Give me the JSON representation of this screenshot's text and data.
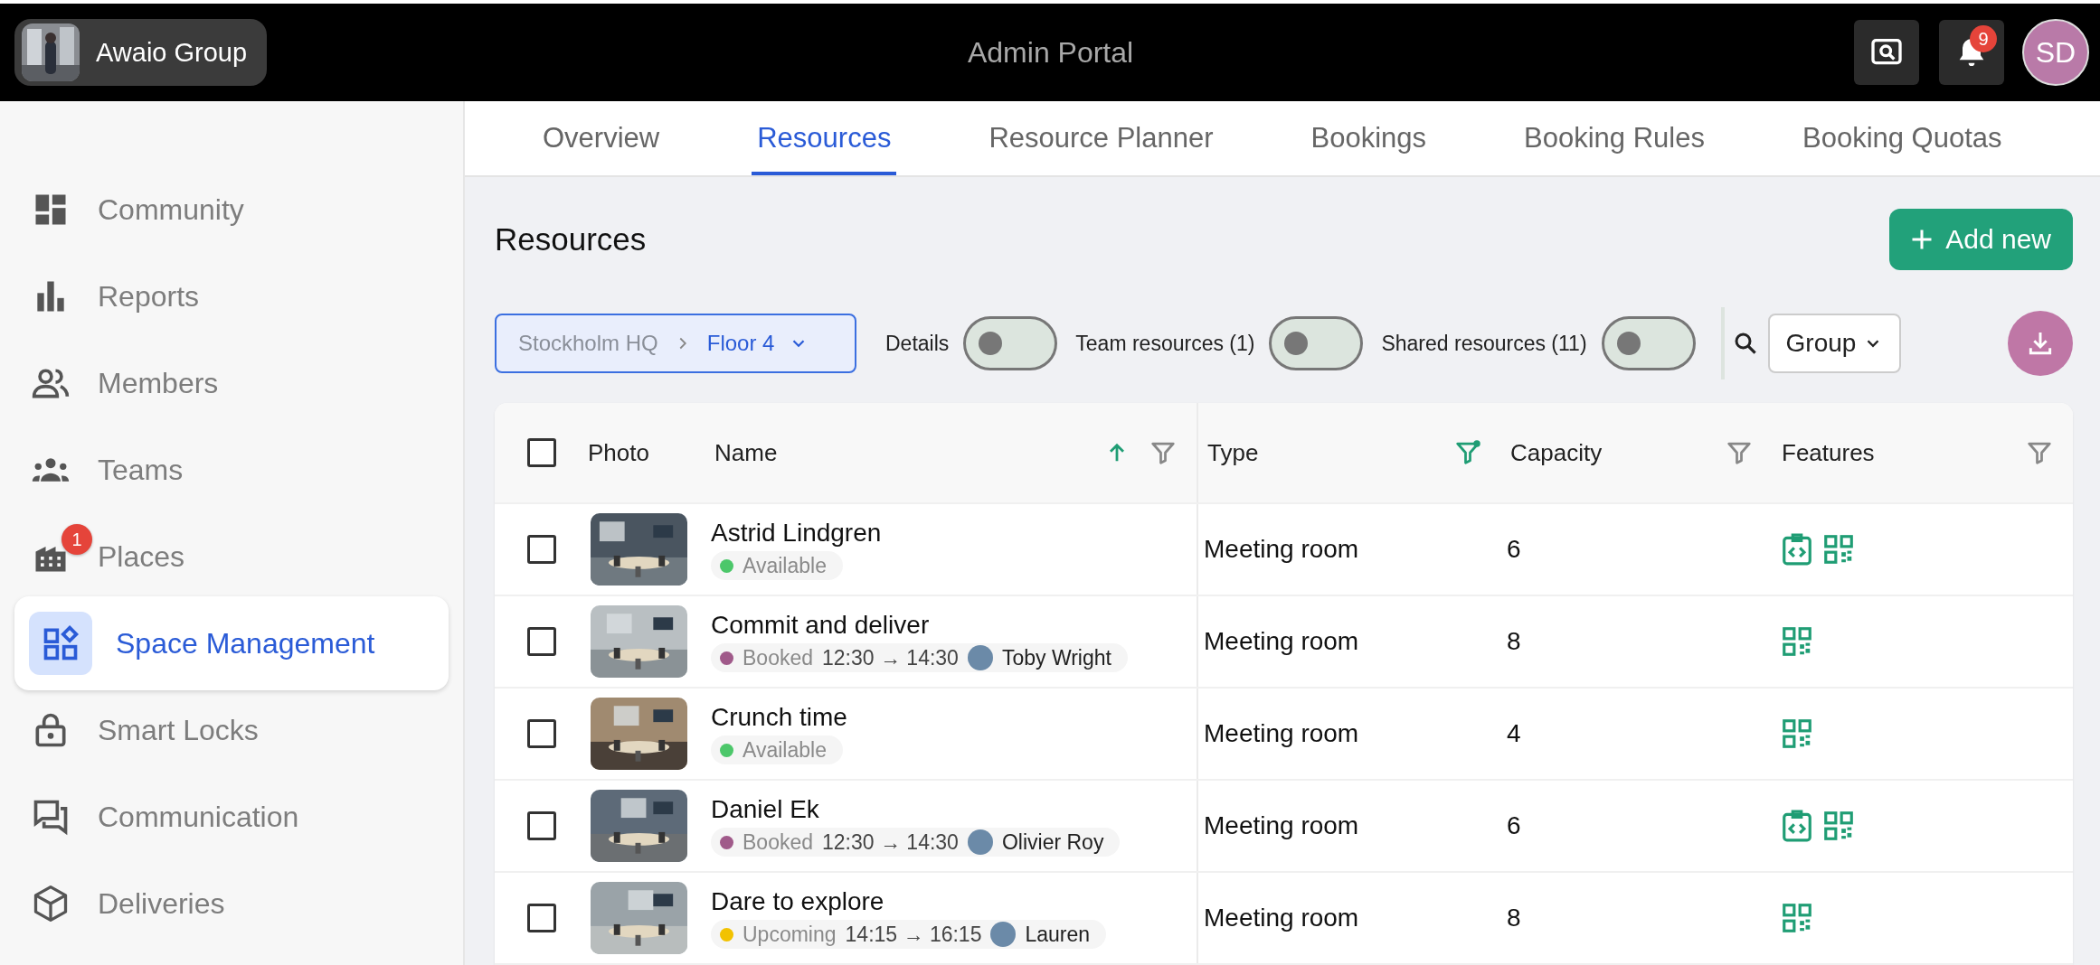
{
  "header": {
    "brand": "Awaio Group",
    "title": "Admin Portal",
    "notifications": "9",
    "avatar": "SD"
  },
  "sidebar": {
    "items": [
      {
        "label": "Community",
        "selected": false
      },
      {
        "label": "Reports",
        "selected": false
      },
      {
        "label": "Members",
        "selected": false
      },
      {
        "label": "Teams",
        "selected": false
      },
      {
        "label": "Places",
        "selected": false,
        "badge": "1"
      },
      {
        "label": "Space Management",
        "selected": true
      },
      {
        "label": "Smart Locks",
        "selected": false
      },
      {
        "label": "Communication",
        "selected": false
      },
      {
        "label": "Deliveries",
        "selected": false
      }
    ]
  },
  "tabs": [
    {
      "label": "Overview",
      "selected": false
    },
    {
      "label": "Resources",
      "selected": true
    },
    {
      "label": "Resource Planner",
      "selected": false
    },
    {
      "label": "Bookings",
      "selected": false
    },
    {
      "label": "Booking Rules",
      "selected": false
    },
    {
      "label": "Booking Quotas",
      "selected": false
    }
  ],
  "page": {
    "title": "Resources",
    "add_button": "Add new"
  },
  "filters": {
    "breadcrumb": [
      "Stockholm HQ",
      "Floor 4"
    ],
    "toggles": [
      {
        "label": "Details",
        "on": false
      },
      {
        "label": "Team resources (1)",
        "on": false
      },
      {
        "label": "Shared resources (11)",
        "on": false
      }
    ],
    "group": "Group"
  },
  "table": {
    "all_checked": false,
    "columns": [
      {
        "label": "Photo"
      },
      {
        "label": "Name",
        "sort_ascending": true,
        "filter_active": false
      },
      {
        "label": "Type",
        "filter_active": true
      },
      {
        "label": "Capacity",
        "filter_active": false
      },
      {
        "label": "Features",
        "filter_active": false
      }
    ],
    "rows": [
      {
        "checked": false,
        "name": "Astrid Lindgren",
        "status": {
          "label": "Available",
          "color": "#4cc76a"
        },
        "type": "Meeting room",
        "capacity": "6",
        "features": [
          {
            "kind": "display"
          },
          {
            "kind": "qr"
          }
        ]
      },
      {
        "checked": false,
        "name": "Commit and deliver",
        "status": {
          "label": "Booked",
          "color": "#a05a8a",
          "time": "12:30 → 14:30",
          "person": "Toby Wright"
        },
        "type": "Meeting room",
        "capacity": "8",
        "features": [
          {
            "kind": "qr"
          }
        ]
      },
      {
        "checked": false,
        "name": "Crunch time",
        "status": {
          "label": "Available",
          "color": "#4cc76a"
        },
        "type": "Meeting room",
        "capacity": "4",
        "features": [
          {
            "kind": "qr"
          }
        ]
      },
      {
        "checked": false,
        "name": "Daniel Ek",
        "status": {
          "label": "Booked",
          "color": "#a05a8a",
          "time": "12:30 → 14:30",
          "person": "Olivier Roy"
        },
        "type": "Meeting room",
        "capacity": "6",
        "features": [
          {
            "kind": "display"
          },
          {
            "kind": "qr"
          }
        ]
      },
      {
        "checked": false,
        "name": "Dare to explore",
        "status": {
          "label": "Upcoming",
          "color": "#f2c200",
          "time": "14:15 → 16:15",
          "person": "Lauren"
        },
        "type": "Meeting room",
        "capacity": "8",
        "features": [
          {
            "kind": "qr"
          }
        ]
      }
    ]
  }
}
